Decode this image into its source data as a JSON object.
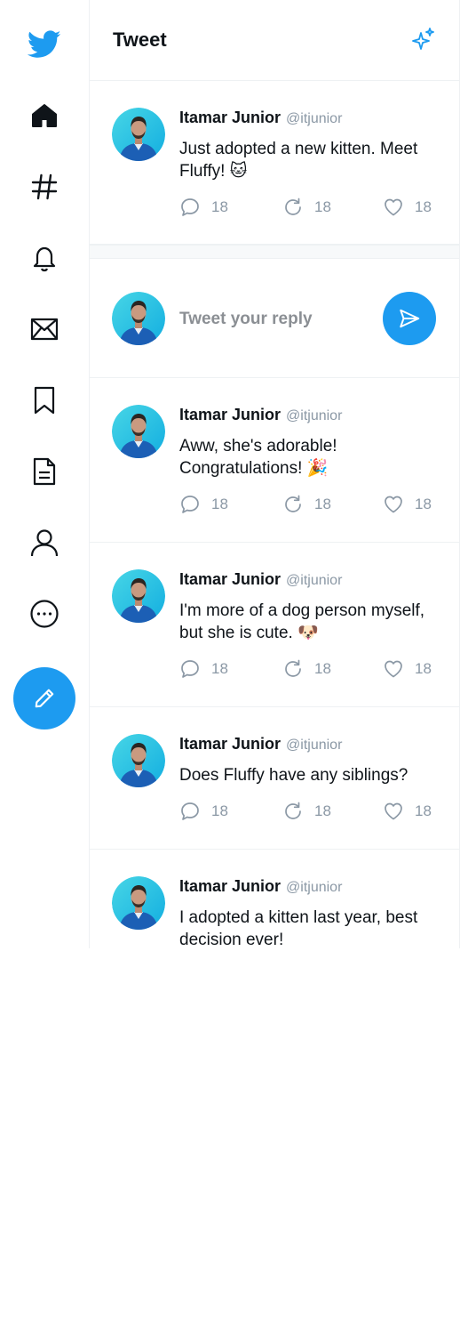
{
  "app": {
    "brand": "twitter-bird-icon",
    "accent": "#1d9bf0"
  },
  "sidebar": {
    "items": [
      {
        "icon": "home-icon"
      },
      {
        "icon": "hashtag-icon"
      },
      {
        "icon": "bell-icon"
      },
      {
        "icon": "mail-icon"
      },
      {
        "icon": "bookmark-icon"
      },
      {
        "icon": "document-icon"
      },
      {
        "icon": "profile-icon"
      },
      {
        "icon": "more-icon"
      }
    ],
    "compose": {
      "icon": "pencil-icon"
    }
  },
  "header": {
    "title": "Tweet",
    "icon": "sparkle-icon"
  },
  "main_tweet": {
    "name": "Itamar Junior",
    "handle": "@itjunior",
    "text": "Just adopted a new kitten. Meet Fluffy! 🐱",
    "replies": "18",
    "retweets": "18",
    "likes": "18"
  },
  "reply_box": {
    "placeholder": "Tweet your reply",
    "send_icon": "send-icon"
  },
  "replies": [
    {
      "name": "Itamar Junior",
      "handle": "@itjunior",
      "text": "Aww, she's adorable! Congratulations! 🎉",
      "replies": "18",
      "retweets": "18",
      "likes": "18"
    },
    {
      "name": "Itamar Junior",
      "handle": "@itjunior",
      "text": "I'm more of a dog person myself, but she is cute. 🐶",
      "replies": "18",
      "retweets": "18",
      "likes": "18"
    },
    {
      "name": "Itamar Junior",
      "handle": "@itjunior",
      "text": "Does Fluffy have any siblings?",
      "replies": "18",
      "retweets": "18",
      "likes": "18"
    },
    {
      "name": "Itamar Junior",
      "handle": "@itjunior",
      "text": "I adopted a kitten last year, best decision ever!"
    }
  ]
}
